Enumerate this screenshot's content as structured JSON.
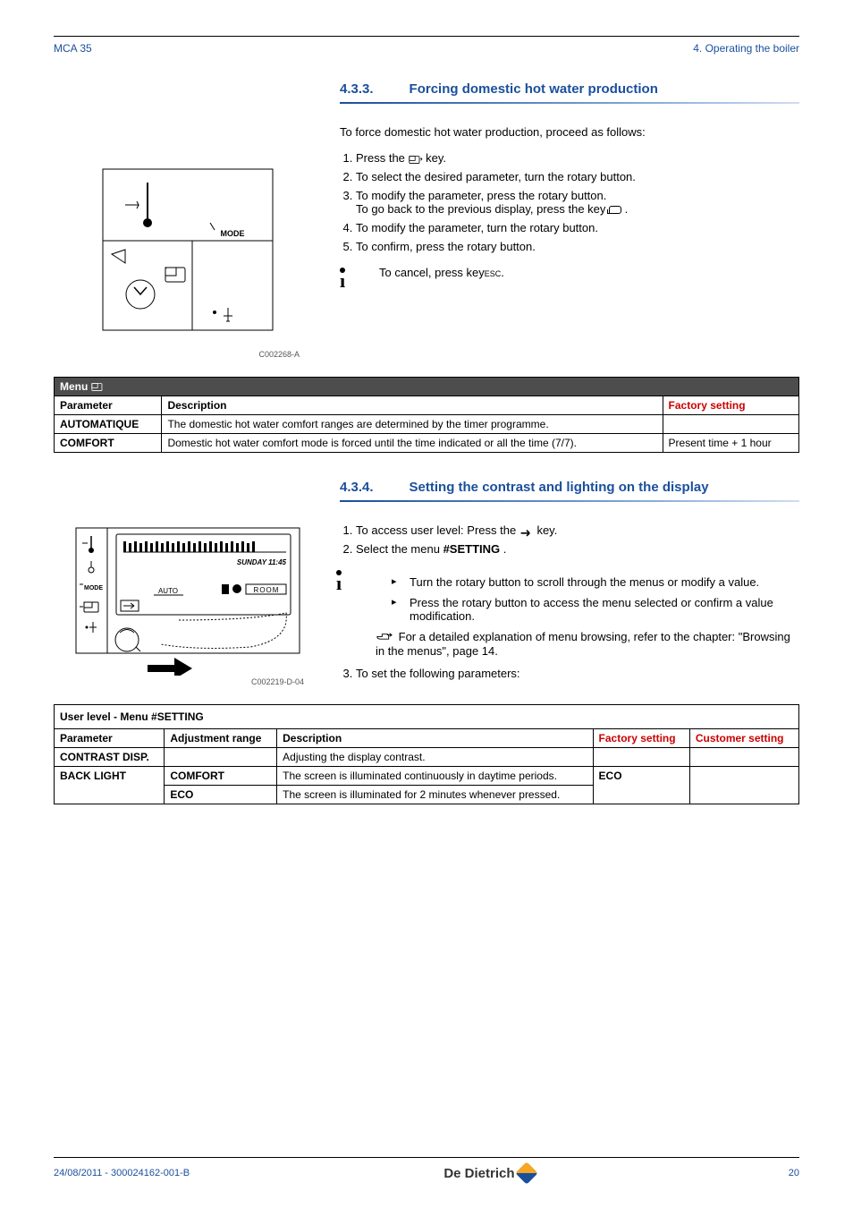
{
  "header": {
    "left": "MCA 35",
    "right": "4.  Operating the boiler"
  },
  "section433": {
    "num": "4.3.3.",
    "title": "Forcing domestic hot water production",
    "intro": "To force domestic hot water production, proceed as follows:",
    "steps": [
      "Press the <key> key.",
      "To select the desired parameter, turn the rotary button.",
      "To modify the parameter, press the rotary button.",
      "To go back to the previous display, press the key <back>.",
      "To modify the parameter, turn the rotary button.",
      "To confirm, press the rotary button."
    ],
    "step1": "Press the ",
    "step1_after": " key.",
    "step2": "To select the desired parameter, turn the rotary button.",
    "step3a": "To modify the parameter, press the rotary button.",
    "step3b": "To go back to the previous display, press the key ",
    "step3b_after": ".",
    "step4": "To modify the parameter, turn the rotary button.",
    "step5": "To confirm, press the rotary button.",
    "cancel_pre": "To cancel, press key",
    "cancel_esc": "ESC",
    "cancel_post": "."
  },
  "figure1": {
    "mode_label": "MODE",
    "ref": "C002268-A"
  },
  "table1": {
    "menu_title": "Menu ",
    "col_param": "Parameter",
    "col_desc": "Description",
    "col_factory": "Factory setting",
    "rows": [
      {
        "param": "AUTOMATIQUE",
        "desc": "The domestic hot water comfort ranges are determined by the timer programme.",
        "factory": ""
      },
      {
        "param": "COMFORT",
        "desc": "Domestic hot water comfort mode is forced until the time indicated or all the time (7/7).",
        "factory": "Present time + 1 hour"
      }
    ]
  },
  "section434": {
    "num": "4.3.4.",
    "title": "Setting the contrast and lighting on the display",
    "step1_pre": "To access user level: Press the ",
    "step1_post": " key.",
    "step2_pre": "Select the menu ",
    "step2_bold": "#SETTING",
    "step2_post": ".",
    "bullet1": "Turn the rotary button to scroll through the menus or modify a value.",
    "bullet2": "Press the rotary button to access the menu selected or confirm a value modification.",
    "hand_text": "For a detailed explanation of menu browsing, refer to the chapter:  \"Browsing in the menus\", page 14.",
    "step3": "To set the following parameters:"
  },
  "figure2": {
    "day_time": "SUNDAY 11:45",
    "auto": "AUTO",
    "mode": "MODE",
    "ref": "C002219-D-04"
  },
  "table2": {
    "title": "User level - Menu #SETTING",
    "col_param": "Parameter",
    "col_range": "Adjustment range",
    "col_desc": "Description",
    "col_factory": "Factory setting",
    "col_customer": "Customer setting",
    "rows": [
      {
        "param": "CONTRAST DISP.",
        "range": "",
        "desc": "Adjusting the display contrast.",
        "factory": "",
        "customer": ""
      },
      {
        "param": "BACK LIGHT",
        "range": "COMFORT",
        "desc": "The screen is illuminated continuously in daytime periods.",
        "factory": "ECO",
        "customer": ""
      },
      {
        "param": "",
        "range": "ECO",
        "desc": "The screen is illuminated for 2 minutes whenever pressed.",
        "factory": "",
        "customer": ""
      }
    ]
  },
  "footer": {
    "date_ref": "24/08/2011  - 300024162-001-B",
    "brand": "De Dietrich",
    "page": "20"
  }
}
